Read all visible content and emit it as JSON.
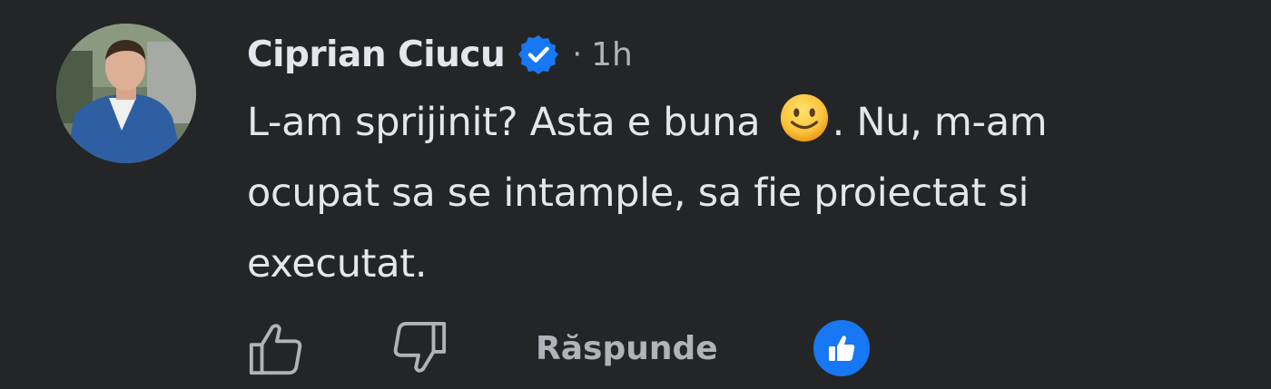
{
  "comment": {
    "author": "Ciprian Ciucu",
    "separator": "·",
    "time": "1h",
    "text_before_emoji": "L-am sprijinit? Asta e buna ",
    "emoji": "slightly-smiling-face-icon",
    "text_after_emoji": ". Nu, m-am ocupat sa se intample, sa fie proiectat si executat."
  },
  "actions": {
    "reply_label": "Răspunde"
  },
  "colors": {
    "background": "#242526",
    "text_primary": "#e4e6eb",
    "text_secondary": "#b0b3b8",
    "verified_badge": "#1877f2",
    "like_badge": "#1877f2"
  }
}
